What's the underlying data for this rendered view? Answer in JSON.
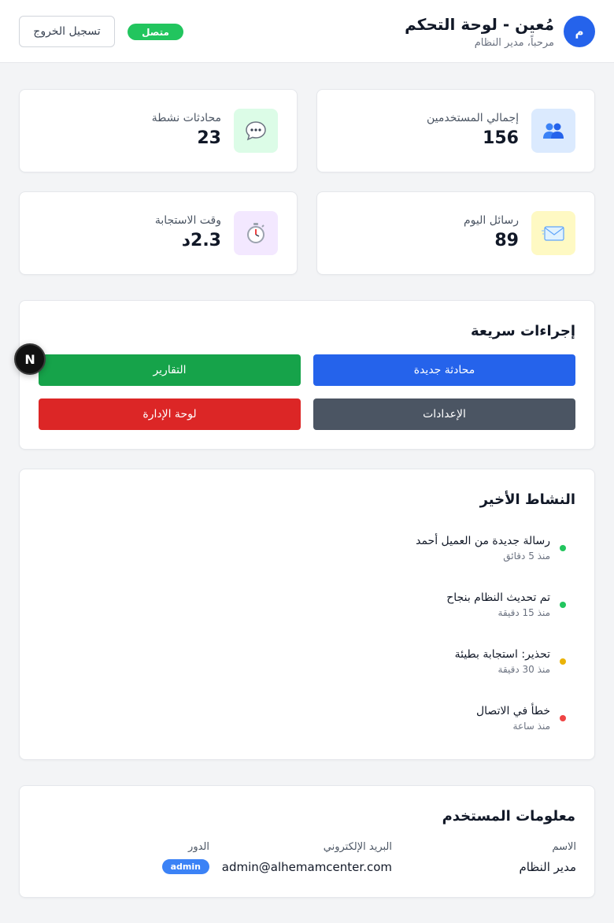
{
  "header": {
    "avatar_letter": "م",
    "title": "مُعين - لوحة التحكم",
    "subtitle": "مرحباً، مدير النظام",
    "status": "متصل",
    "logout_label": "تسجيل الخروج"
  },
  "stats": [
    {
      "label": "إجمالي المستخدمين",
      "value": "156",
      "icon": "users-icon",
      "color": "#dbeafe"
    },
    {
      "label": "محادثات نشطة",
      "value": "23",
      "icon": "chat-bubble-icon",
      "color": "#dcfce7"
    },
    {
      "label": "رسائل اليوم",
      "value": "89",
      "icon": "envelope-icon",
      "color": "#fef9c3"
    },
    {
      "label": "وقت الاستجابة",
      "value": "2.3د",
      "icon": "stopwatch-icon",
      "color": "#f3e8ff"
    }
  ],
  "quick_actions": {
    "title": "إجراءات سريعة",
    "buttons": [
      {
        "label": "محادثة جديدة",
        "color": "#2563eb"
      },
      {
        "label": "التقارير",
        "color": "#16a34a"
      },
      {
        "label": "الإعدادات",
        "color": "#4b5563"
      },
      {
        "label": "لوحة الإدارة",
        "color": "#dc2626"
      }
    ]
  },
  "recent_activity": {
    "title": "النشاط الأخير",
    "items": [
      {
        "text": "رسالة جديدة من العميل أحمد",
        "time": "منذ 5 دقائق",
        "color": "#22c55e"
      },
      {
        "text": "تم تحديث النظام بنجاح",
        "time": "منذ 15 دقيقة",
        "color": "#22c55e"
      },
      {
        "text": "تحذير: استجابة بطيئة",
        "time": "منذ 30 دقيقة",
        "color": "#eab308"
      },
      {
        "text": "خطأ في الاتصال",
        "time": "منذ ساعة",
        "color": "#ef4444"
      }
    ]
  },
  "user_info": {
    "title": "معلومات المستخدم",
    "name_label": "الاسم",
    "name_value": "مدير النظام",
    "email_label": "البريد الإلكتروني",
    "email_value": "admin@alhemamcenter.com",
    "role_label": "الدور",
    "role_value": "admin"
  },
  "overlay": {
    "badge_letter": "N"
  }
}
